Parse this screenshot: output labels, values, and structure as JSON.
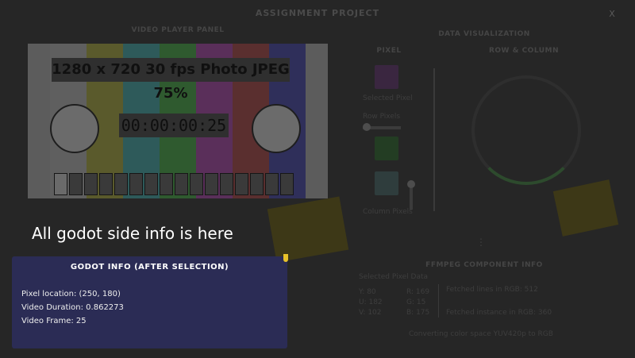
{
  "app": {
    "title": "ASSIGNMENT PROJECT",
    "close_label": "X"
  },
  "video_panel": {
    "title": "VIDEO PLAYER PANEL",
    "overlay_text": "1280 x 720 30 fps Photo JPEG 75%",
    "timecode": "00:00:00:25",
    "bar_colors": [
      "#5f5f5f",
      "#5a5a2c",
      "#2e5a5a",
      "#2f5a2f",
      "#5a2f5a",
      "#5a2f2f",
      "#2f2f5a"
    ]
  },
  "data_vis": {
    "title": "DATA VISUALIZATION",
    "pixel_heading": "PIXEL",
    "row_col_heading": "ROW & COLUMN",
    "selected_pixel_label": "Selected Pixel",
    "row_pixels_label": "Row Pixels",
    "column_pixels_label": "Column Pixels"
  },
  "ffmpeg": {
    "title": "FFMPEG COMPONENT INFO",
    "selected_pixel_data": "Selected Pixel Data",
    "yuv": [
      "Y: 80",
      "U: 182",
      "V: 102"
    ],
    "rgb": [
      "R: 169",
      "G: 15",
      "B: 175"
    ],
    "fetched_lines": "Fetched lines in RGB: 512",
    "fetched_instance": "Fetched instance in RGB: 360",
    "converting": "Converting color space YUV420p to RGB"
  },
  "caption": "All godot side info is here",
  "godot_info": {
    "title": "GODOT INFO (AFTER SELECTION)",
    "pixel_location": "Pixel location: (250, 180)",
    "video_duration": "Video Duration: 0.862273",
    "video_frame": "Video Frame: 25"
  },
  "colors": {
    "info_bg": "#2b2c55",
    "overlay_dim": "#262626"
  }
}
